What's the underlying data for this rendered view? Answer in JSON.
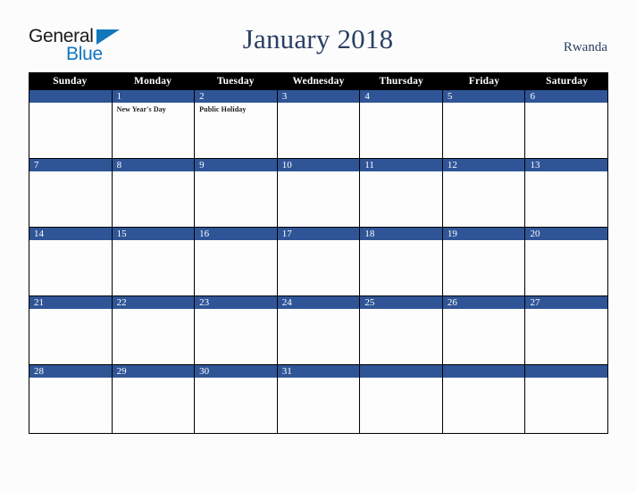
{
  "brand": {
    "name_part1": "General",
    "name_part2": "Blue",
    "triangle_color": "#1276bd"
  },
  "header": {
    "title": "January 2018",
    "country": "Rwanda"
  },
  "colors": {
    "weekday_header_bg": "#000000",
    "weekday_header_text": "#ffffff",
    "date_bar_bg": "#2f5597",
    "date_text": "#ffffff",
    "title_text": "#2a3f63",
    "page_bg": "#fcfcfc",
    "grid_line": "#000000"
  },
  "calendar": {
    "weekdays": [
      "Sunday",
      "Monday",
      "Tuesday",
      "Wednesday",
      "Thursday",
      "Friday",
      "Saturday"
    ],
    "weeks": [
      [
        {
          "date": "",
          "events": []
        },
        {
          "date": "1",
          "events": [
            "New Year's Day"
          ]
        },
        {
          "date": "2",
          "events": [
            "Public Holiday"
          ]
        },
        {
          "date": "3",
          "events": []
        },
        {
          "date": "4",
          "events": []
        },
        {
          "date": "5",
          "events": []
        },
        {
          "date": "6",
          "events": []
        }
      ],
      [
        {
          "date": "7",
          "events": []
        },
        {
          "date": "8",
          "events": []
        },
        {
          "date": "9",
          "events": []
        },
        {
          "date": "10",
          "events": []
        },
        {
          "date": "11",
          "events": []
        },
        {
          "date": "12",
          "events": []
        },
        {
          "date": "13",
          "events": []
        }
      ],
      [
        {
          "date": "14",
          "events": []
        },
        {
          "date": "15",
          "events": []
        },
        {
          "date": "16",
          "events": []
        },
        {
          "date": "17",
          "events": []
        },
        {
          "date": "18",
          "events": []
        },
        {
          "date": "19",
          "events": []
        },
        {
          "date": "20",
          "events": []
        }
      ],
      [
        {
          "date": "21",
          "events": []
        },
        {
          "date": "22",
          "events": []
        },
        {
          "date": "23",
          "events": []
        },
        {
          "date": "24",
          "events": []
        },
        {
          "date": "25",
          "events": []
        },
        {
          "date": "26",
          "events": []
        },
        {
          "date": "27",
          "events": []
        }
      ],
      [
        {
          "date": "28",
          "events": []
        },
        {
          "date": "29",
          "events": []
        },
        {
          "date": "30",
          "events": []
        },
        {
          "date": "31",
          "events": []
        },
        {
          "date": "",
          "events": []
        },
        {
          "date": "",
          "events": []
        },
        {
          "date": "",
          "events": []
        }
      ]
    ]
  }
}
